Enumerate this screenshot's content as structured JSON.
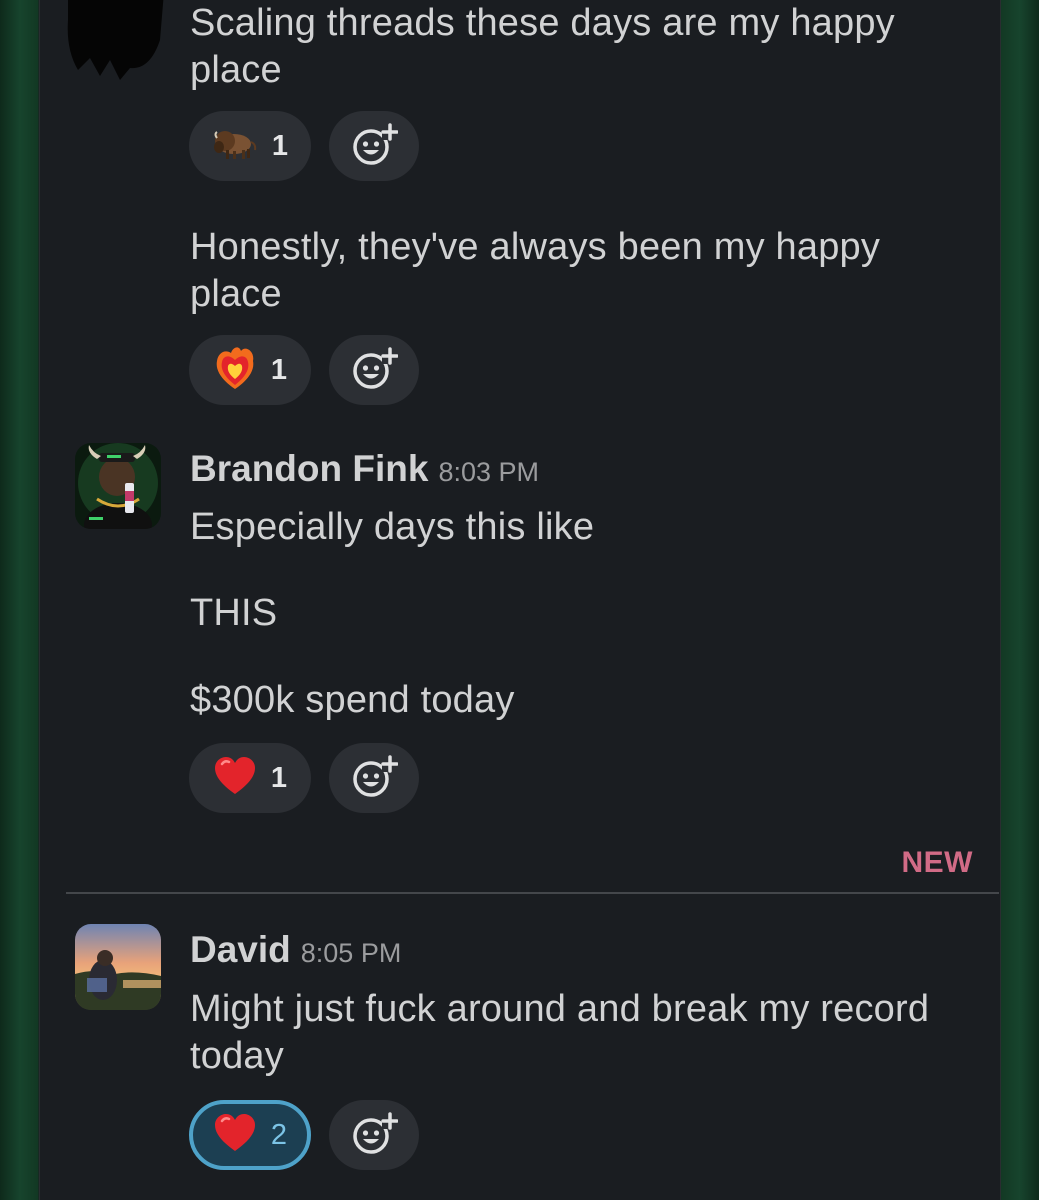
{
  "messages": [
    {
      "text": "Scaling threads these days are my happy\nplace",
      "reaction": {
        "emoji": "bison",
        "count": "1"
      }
    },
    {
      "text": "Honestly, they've always been my happy\nplace",
      "reaction": {
        "emoji": "heart-on-fire",
        "count": "1"
      }
    },
    {
      "sender": "Brandon Fink",
      "time": "8:03 PM",
      "lines": [
        "Especially days this like",
        "THIS",
        "$300k spend today"
      ],
      "reaction": {
        "emoji": "red-heart",
        "count": "1"
      }
    },
    {
      "sender": "David",
      "time": "8:05 PM",
      "text": "Might just fuck around and break my record\ntoday",
      "reaction": {
        "emoji": "red-heart",
        "count": "2",
        "active": true
      }
    }
  ],
  "divider": {
    "label": "NEW",
    "color": "#d16b86"
  },
  "colors": {
    "background": "#1a1d21",
    "text": "#d1d2d3",
    "active_reaction_border": "#4ea2c9"
  }
}
